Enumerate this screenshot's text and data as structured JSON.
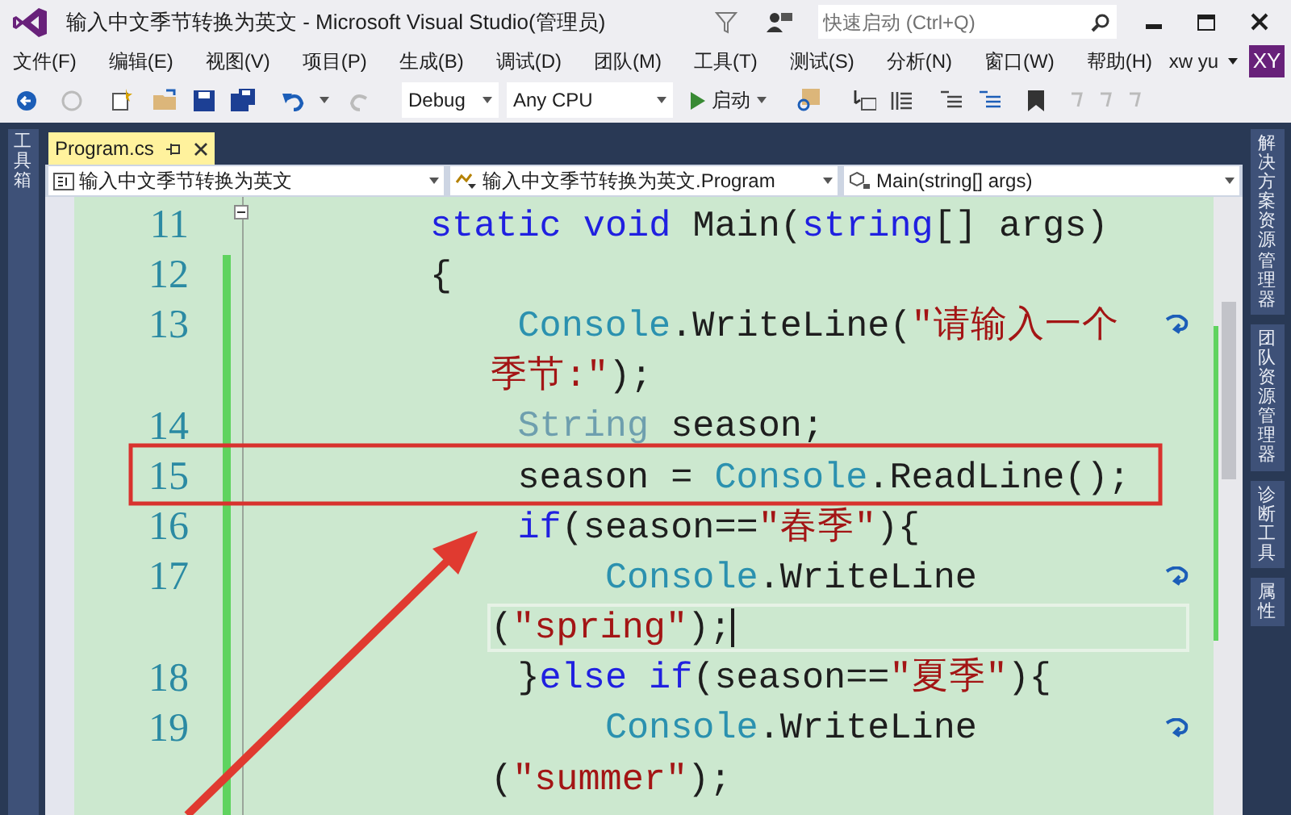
{
  "window": {
    "title": "输入中文季节转换为英文 - Microsoft Visual Studio(管理员)",
    "quick_launch": {
      "placeholder": "快速启动 (Ctrl+Q)"
    }
  },
  "menu": [
    "文件(F)",
    "编辑(E)",
    "视图(V)",
    "项目(P)",
    "生成(B)",
    "调试(D)",
    "团队(M)",
    "工具(T)",
    "测试(S)",
    "分析(N)",
    "窗口(W)",
    "帮助(H)"
  ],
  "account": {
    "user": "xw yu",
    "initials": "XY"
  },
  "toolbar": {
    "configuration": "Debug",
    "platform": "Any CPU",
    "start": "启动"
  },
  "left_panel": "工具箱",
  "right_panels": [
    "解决方案资源管理器",
    "团队资源管理器",
    "诊断工具",
    "属性"
  ],
  "tabs": [
    {
      "label": "Program.cs",
      "selected": true
    }
  ],
  "navigation": [
    "输入中文季节转换为英文",
    "输入中文季节转换为英文.Program",
    "Main(string[] args)"
  ],
  "code": [
    {
      "number": "11",
      "foldable": true,
      "current": false,
      "tokens": [
        {
          "kind": "keyword",
          "text": "        static "
        },
        {
          "kind": "keyword",
          "text": "void "
        },
        {
          "kind": "plain",
          "text": "Main("
        },
        {
          "kind": "keyword",
          "text": "string"
        },
        {
          "kind": "plain",
          "text": "[] args)"
        }
      ]
    },
    {
      "number": "12",
      "foldable": false,
      "current": false,
      "tokens": [
        {
          "kind": "plain",
          "text": "        {"
        }
      ]
    },
    {
      "number": "13",
      "foldable": false,
      "current": false,
      "tokens": [
        {
          "kind": "type",
          "text": "            Console"
        },
        {
          "kind": "plain",
          "text": ".WriteLine("
        },
        {
          "kind": "string",
          "text": "\"请输入一个"
        }
      ]
    },
    {
      "foldable": false,
      "current": false,
      "tokens": [
        {
          "kind": "string",
          "text": "季节:\""
        },
        {
          "kind": "plain",
          "text": ");"
        }
      ]
    },
    {
      "number": "14",
      "foldable": false,
      "current": false,
      "tokens": [
        {
          "kind": "faded",
          "text": "            String"
        },
        {
          "kind": "plain",
          "text": " season;"
        }
      ]
    },
    {
      "number": "15",
      "foldable": false,
      "current": false,
      "tokens": [
        {
          "kind": "plain",
          "text": "            season = "
        },
        {
          "kind": "type",
          "text": "Console"
        },
        {
          "kind": "plain",
          "text": ".ReadLine();"
        }
      ]
    },
    {
      "number": "16",
      "foldable": false,
      "current": false,
      "tokens": [
        {
          "kind": "keyword",
          "text": "            if"
        },
        {
          "kind": "plain",
          "text": "(season=="
        },
        {
          "kind": "string",
          "text": "\"春季\""
        },
        {
          "kind": "plain",
          "text": "){"
        }
      ]
    },
    {
      "number": "17",
      "foldable": false,
      "current": false,
      "tokens": [
        {
          "kind": "type",
          "text": "                Console"
        },
        {
          "kind": "plain",
          "text": ".WriteLine"
        }
      ]
    },
    {
      "foldable": false,
      "current": true,
      "tokens": [
        {
          "kind": "plain",
          "text": "("
        },
        {
          "kind": "string",
          "text": "\"spring\""
        },
        {
          "kind": "plain",
          "text": ");"
        }
      ]
    },
    {
      "number": "18",
      "foldable": false,
      "current": false,
      "tokens": [
        {
          "kind": "plain",
          "text": "            }"
        },
        {
          "kind": "keyword",
          "text": "else if"
        },
        {
          "kind": "plain",
          "text": "(season=="
        },
        {
          "kind": "string",
          "text": "\"夏季\""
        },
        {
          "kind": "plain",
          "text": "){"
        }
      ]
    },
    {
      "number": "19",
      "foldable": false,
      "current": false,
      "tokens": [
        {
          "kind": "type",
          "text": "                Console"
        },
        {
          "kind": "plain",
          "text": ".WriteLine"
        }
      ]
    },
    {
      "foldable": false,
      "current": false,
      "tokens": [
        {
          "kind": "plain",
          "text": "("
        },
        {
          "kind": "string",
          "text": "\"summer\""
        },
        {
          "kind": "plain",
          "text": ");"
        }
      ]
    }
  ]
}
